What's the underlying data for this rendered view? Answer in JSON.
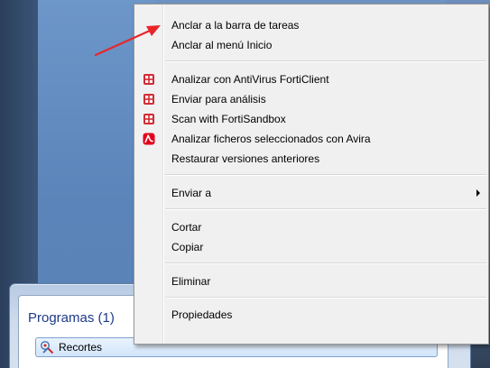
{
  "start_menu": {
    "programs_heading": "Programas (1)",
    "program": {
      "label": "Recortes",
      "icon": "snipping-tool-icon"
    }
  },
  "context_menu": {
    "items": [
      {
        "label": "Anclar a la barra de tareas"
      },
      {
        "label": "Anclar al menú Inicio"
      },
      {
        "label": "Analizar con AntiVirus FortiClient",
        "icon": "forticlient-shield-icon"
      },
      {
        "label": "Enviar para análisis",
        "icon": "forticlient-shield-icon"
      },
      {
        "label": "Scan with FortiSandbox",
        "icon": "forticlient-shield-icon"
      },
      {
        "label": "Analizar ficheros seleccionados con Avira",
        "icon": "avira-umbrella-icon"
      },
      {
        "label": "Restaurar versiones anteriores"
      },
      {
        "label": "Enviar a",
        "has_submenu": true
      },
      {
        "label": "Cortar"
      },
      {
        "label": "Copiar"
      },
      {
        "label": "Eliminar"
      },
      {
        "label": "Propiedades"
      }
    ]
  },
  "colors": {
    "annotation_arrow": "#e8262a",
    "forti_red": "#d22b35",
    "avira_red": "#e3001b",
    "programs_heading": "#1e3a8a"
  }
}
